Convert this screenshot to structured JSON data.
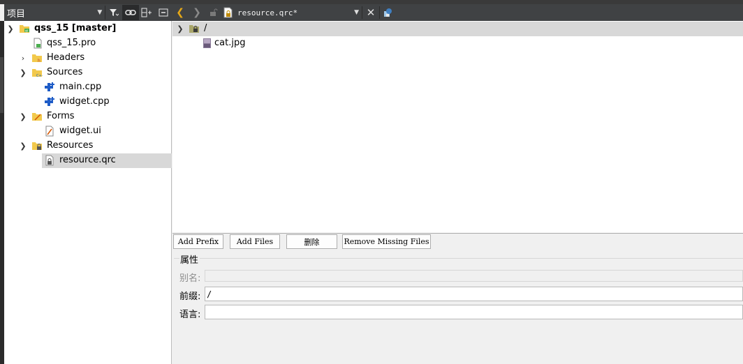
{
  "left_panel": {
    "selector_label": "项目",
    "tree": [
      {
        "label": "qss_15 [master]",
        "bold": true,
        "icon": "project-folder-icon",
        "expanded": true,
        "level": 0
      },
      {
        "label": "qss_15.pro",
        "icon": "pro-file-icon",
        "level": 1
      },
      {
        "label": "Headers",
        "icon": "headers-folder-icon",
        "expanded": false,
        "level": 1
      },
      {
        "label": "Sources",
        "icon": "sources-folder-icon",
        "expanded": true,
        "level": 1
      },
      {
        "label": "main.cpp",
        "icon": "cpp-file-icon",
        "level": 2
      },
      {
        "label": "widget.cpp",
        "icon": "cpp-file-icon",
        "level": 2
      },
      {
        "label": "Forms",
        "icon": "forms-folder-icon",
        "expanded": true,
        "level": 1
      },
      {
        "label": "widget.ui",
        "icon": "ui-file-icon",
        "level": 2
      },
      {
        "label": "Resources",
        "icon": "resources-folder-icon",
        "expanded": true,
        "level": 1
      },
      {
        "label": "resource.qrc",
        "icon": "qrc-file-icon",
        "level": 2,
        "selected": true
      }
    ]
  },
  "editor": {
    "document": "resource.qrc*",
    "resource_tree": [
      {
        "label": "/",
        "icon": "prefix-folder-icon",
        "expanded": true
      },
      {
        "label": "cat.jpg",
        "icon": "image-file-icon"
      }
    ]
  },
  "buttons": {
    "add_prefix": "Add Prefix",
    "add_files": "Add Files",
    "delete": "删除",
    "remove_missing": "Remove Missing Files"
  },
  "properties": {
    "title": "属性",
    "alias_label": "别名:",
    "alias_value": "",
    "prefix_label": "前缀:",
    "prefix_value": "/",
    "language_label": "语言:",
    "language_value": ""
  },
  "colors": {
    "toolbar_bg": "#404244",
    "selection": "#d8d8d8",
    "back_arrow": "#e6a817"
  }
}
